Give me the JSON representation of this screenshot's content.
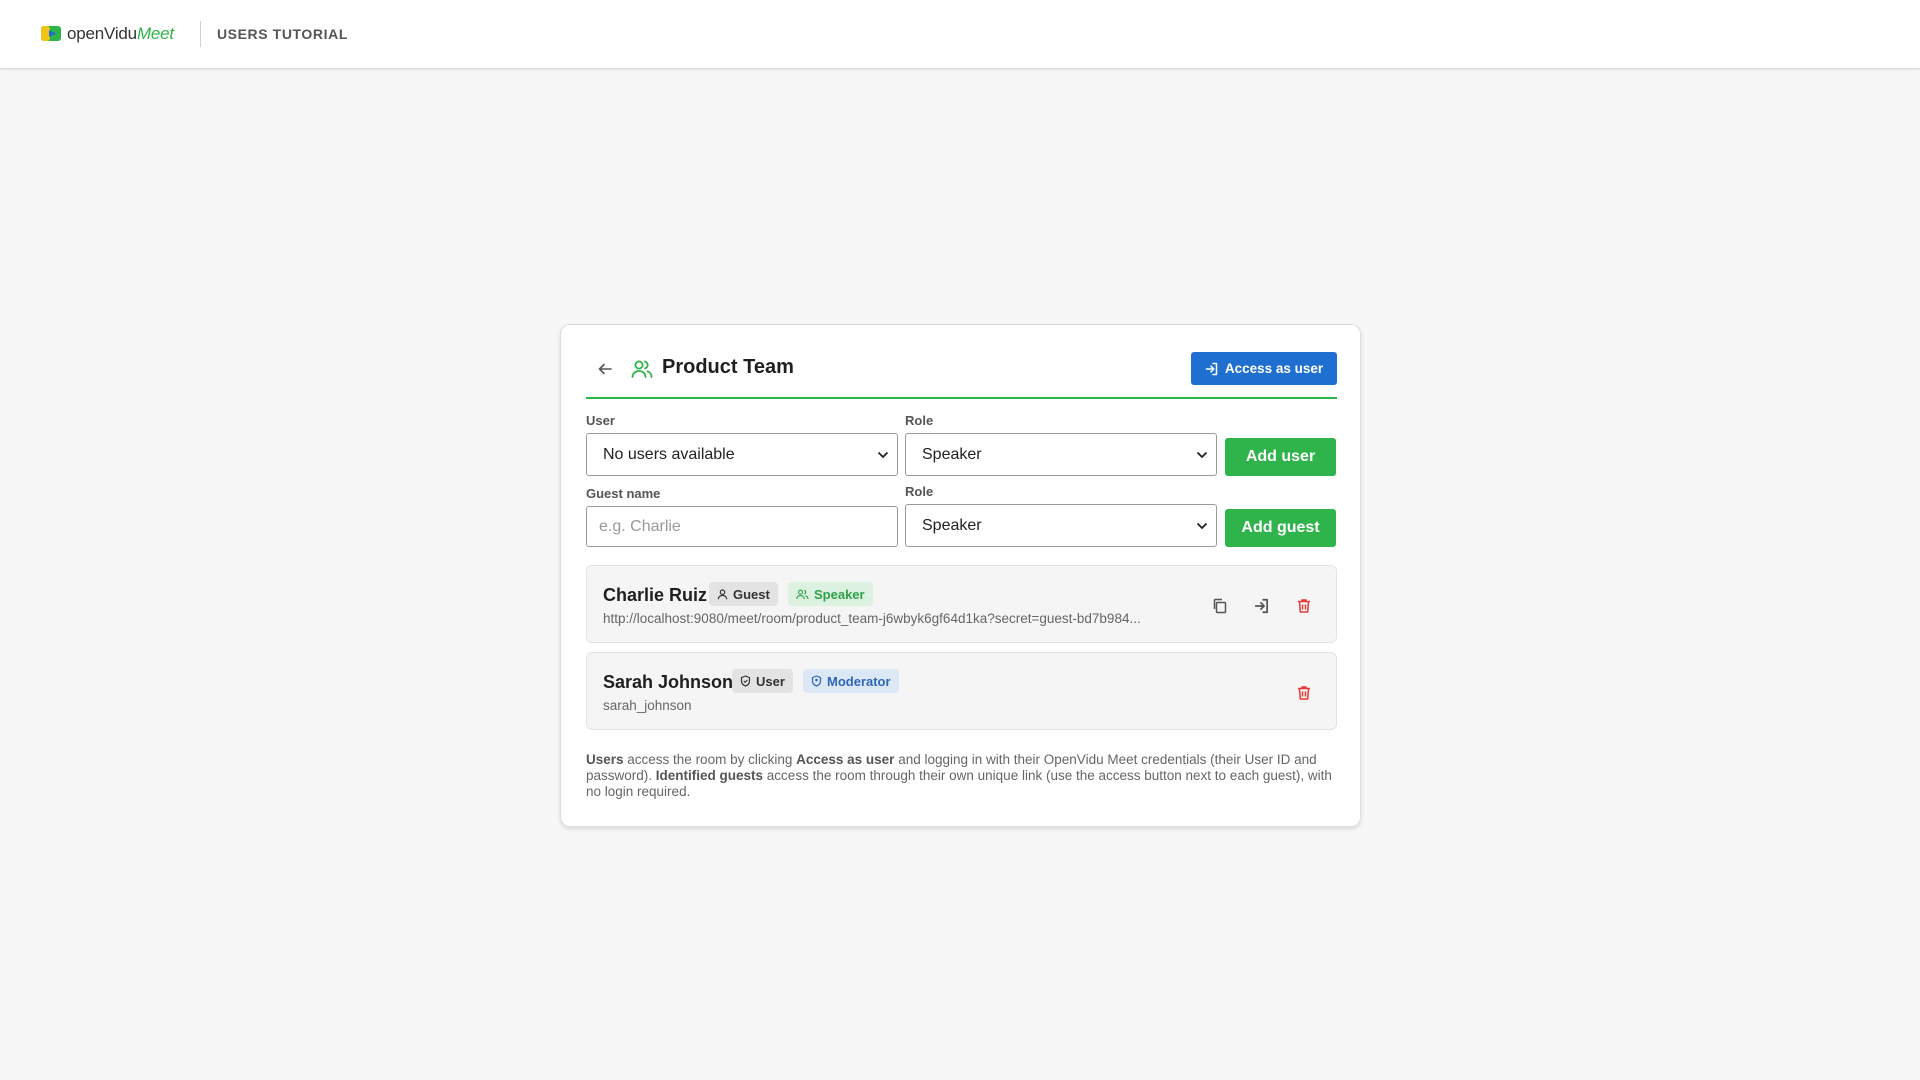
{
  "header": {
    "brand_open": "openVidu",
    "brand_meet": "Meet",
    "tutorial_label": "USERS TUTORIAL"
  },
  "room": {
    "title": "Product Team",
    "access_button": "Access as user"
  },
  "user_form": {
    "user_label": "User",
    "user_value": "No users available",
    "role_label": "Role",
    "role_value": "Speaker",
    "add_button": "Add user"
  },
  "guest_form": {
    "name_label": "Guest name",
    "name_placeholder": "e.g. Charlie",
    "role_label": "Role",
    "role_value": "Speaker",
    "add_button": "Add guest"
  },
  "members": [
    {
      "name": "Charlie Ruiz",
      "type_badge": "Guest",
      "role_badge": "Speaker",
      "subtitle": "http://localhost:9080/meet/room/product_team-j6wbyk6gf64d1ka?secret=guest-bd7b984..."
    },
    {
      "name": "Sarah Johnson",
      "type_badge": "User",
      "role_badge": "Moderator",
      "subtitle": "sarah_johnson"
    }
  ],
  "footnote": {
    "users": "Users",
    "p1": " access the room by clicking ",
    "access_as_user": "Access as user",
    "p2": " and logging in with their OpenVidu Meet credentials (their User ID and password). ",
    "identified_guests": "Identified guests",
    "p3": " access the room through their own unique link (use the access button next to each guest), with no login required."
  },
  "colors": {
    "brand_green": "#2fb44b",
    "primary_blue": "#1f6fd1",
    "delete_red": "#e53935"
  },
  "icons": {
    "back": "arrow-left-icon",
    "team": "group-icon",
    "access": "login-icon",
    "copy": "copy-icon",
    "enter": "login-icon",
    "delete": "trash-icon"
  }
}
